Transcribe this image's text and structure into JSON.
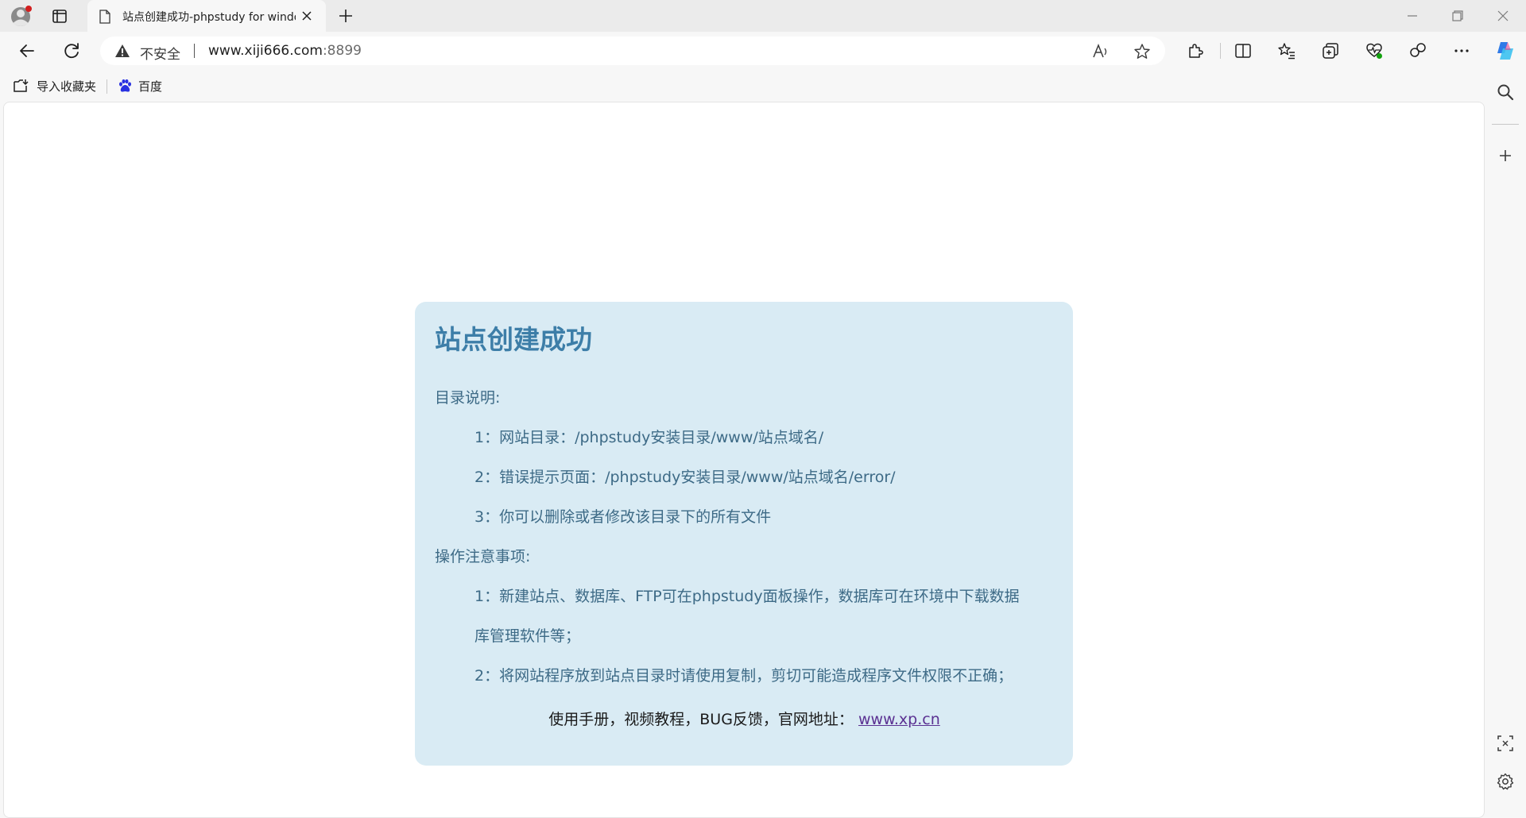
{
  "browser": {
    "tab": {
      "title": "站点创建成功-phpstudy for windows"
    },
    "address": {
      "security_label": "不安全",
      "url_host": "www.xiji666.com",
      "url_port": ":8899"
    },
    "favorites": [
      {
        "label": "导入收藏夹",
        "icon": "import-favorites-icon"
      },
      {
        "label": "百度",
        "icon": "baidu-paw-icon"
      }
    ],
    "colors": {
      "accent": "#0067c0",
      "insecure": "#3a3a3a",
      "chrome_bg": "#f7f7f7",
      "tabstrip_bg": "#ebebeb"
    }
  },
  "page": {
    "title": "站点创建成功",
    "dir_heading": "目录说明:",
    "dir_items": [
      "1：网站目录：/phpstudy安装目录/www/站点域名/",
      "2：错误提示页面：/phpstudy安装目录/www/站点域名/error/",
      "3：你可以删除或者修改该目录下的所有文件"
    ],
    "notes_heading": "操作注意事项:",
    "notes_items": [
      "1：新建站点、数据库、FTP可在phpstudy面板操作，数据库可在环境中下载数据",
      "库管理软件等；",
      "2：将网站程序放到站点目录时请使用复制，剪切可能造成程序文件权限不正确；"
    ],
    "footer_text": "使用手册，视频教程，BUG反馈，官网地址：",
    "footer_link": "www.xp.cn",
    "colors": {
      "card_bg": "#d9ebf4",
      "title": "#3d7ea8",
      "text": "#3d6a86",
      "link": "#5b3192"
    }
  }
}
